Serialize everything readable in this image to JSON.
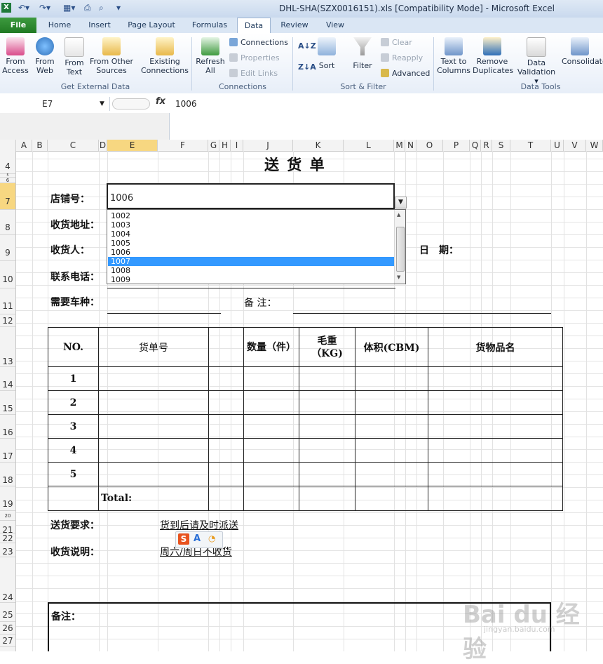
{
  "window": {
    "title": "DHL-SHA(SZX0016151).xls  [Compatibility Mode]  -  Microsoft Excel"
  },
  "tabs": [
    {
      "label": "File"
    },
    {
      "label": "Home"
    },
    {
      "label": "Insert"
    },
    {
      "label": "Page Layout"
    },
    {
      "label": "Formulas"
    },
    {
      "label": "Data"
    },
    {
      "label": "Review"
    },
    {
      "label": "View"
    }
  ],
  "ribbon": {
    "get_external": {
      "from_access": [
        "From",
        "Access"
      ],
      "from_web": [
        "From",
        "Web"
      ],
      "from_text": [
        "From",
        "Text"
      ],
      "from_other": [
        "From Other",
        "Sources"
      ],
      "existing": [
        "Existing",
        "Connections"
      ],
      "group_label": "Get External Data"
    },
    "connections": {
      "refresh": [
        "Refresh",
        "All"
      ],
      "connections": "Connections",
      "properties": "Properties",
      "edit_links": "Edit Links",
      "group_label": "Connections"
    },
    "sort_filter": {
      "sort": "Sort",
      "filter": "Filter",
      "clear": "Clear",
      "reapply": "Reapply",
      "advanced": "Advanced",
      "group_label": "Sort & Filter"
    },
    "data_tools": {
      "text_to_columns": [
        "Text to",
        "Columns"
      ],
      "remove_duplicates": [
        "Remove",
        "Duplicates"
      ],
      "data_validation": [
        "Data",
        "Validation"
      ],
      "consolidate": "Consolidate",
      "group_label": "Data Tools"
    }
  },
  "formula_bar": {
    "name_box": "E7",
    "fx": "fx",
    "value": "1006"
  },
  "columns": [
    "A",
    "B",
    "C",
    "D",
    "E",
    "F",
    "G",
    "H",
    "I",
    "J",
    "K",
    "L",
    "M",
    "N",
    "O",
    "P",
    "Q",
    "R",
    "S",
    "T",
    "U",
    "V",
    "W"
  ],
  "rows": [
    "4",
    "5",
    "6",
    "7",
    "8",
    "9",
    "10",
    "11",
    "12",
    "13",
    "14",
    "15",
    "16",
    "17",
    "18",
    "19",
    "20",
    "21",
    "22",
    "23",
    "24",
    "25",
    "26",
    "27"
  ],
  "sheet": {
    "title": "送 货 单",
    "store_label": "店铺号：",
    "address_label": "收货地址：",
    "receiver_label": "收货人：",
    "date_label": "日　期：",
    "phone_label": "联系电话：",
    "vehicle_label": "需要车种：",
    "remark_label": "备 注：",
    "table_headers": [
      "NO.",
      "货单号",
      "",
      "数量（件）",
      "毛重（KG)",
      "体积(CBM)",
      "货物品名"
    ],
    "row_numbers": [
      "1",
      "2",
      "3",
      "4",
      "5"
    ],
    "total_label": "Total:",
    "delivery_req_label": "送货要求：",
    "delivery_req_value": "货到后请及时派送",
    "receipt_note_label": "收货说明：",
    "receipt_note_value": "周六/周日不收货",
    "notes_label": "备注："
  },
  "cell_editor": {
    "value": "1006"
  },
  "dropdown": {
    "options": [
      "1002",
      "1003",
      "1004",
      "1005",
      "1006",
      "1007",
      "1008",
      "1009"
    ],
    "highlighted": "1007"
  },
  "watermark": {
    "brand": "Bai du 经验",
    "url": "jingyan.baidu.com"
  },
  "colors": {
    "accent_blue": "#3399ff",
    "file_tab_green": "#217a23",
    "selected_header": "#f7d781"
  }
}
